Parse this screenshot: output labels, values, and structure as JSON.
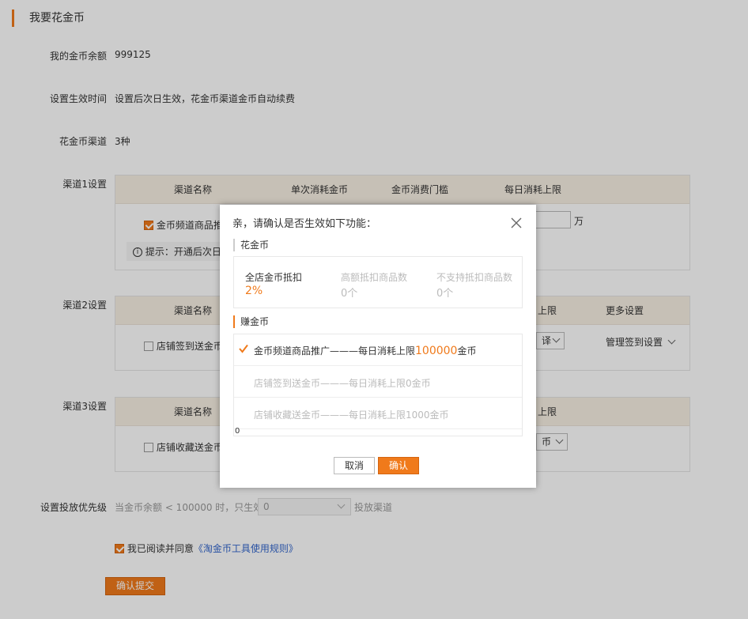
{
  "page": {
    "title": "我要花金币",
    "balance_label": "我的金币余额",
    "balance_value": "999125",
    "effect_label": "设置生效时间",
    "effect_value": "设置后次日生效，花金币渠道金币自动续费",
    "channels_label": "花金币渠道",
    "channels_value": "3种",
    "channel1": {
      "label": "渠道1设置",
      "headers": [
        "渠道名称",
        "单次消耗金币",
        "金币消费门槛",
        "每日消耗上限"
      ],
      "name": "金币频道商品推",
      "unit": "万",
      "tip": "提示：开通后次日"
    },
    "channel2": {
      "label": "渠道2设置",
      "header_name": "渠道名称",
      "header_limit": "上限",
      "header_more": "更多设置",
      "name": "店铺签到送金币",
      "select_tail": "译",
      "manage_link": "管理签到设置"
    },
    "channel3": {
      "label": "渠道3设置",
      "header_name": "渠道名称",
      "header_limit": "上限",
      "name": "店铺收藏送金币",
      "select_tail": "币"
    },
    "priority": {
      "label": "设置投放优先级",
      "prefix": "当金币余额 < 100000 时，只生效",
      "select_value": "0",
      "suffix": "投放渠道"
    },
    "agree": {
      "text": "我已阅读并同意",
      "link": "《淘金币工具使用规则》"
    },
    "submit": "确认提交"
  },
  "modal": {
    "title": "亲，请确认是否生效如下功能：",
    "spend_title": "花金币",
    "spend_items": [
      {
        "label": "全店金币抵扣",
        "value": "2%"
      },
      {
        "label": "高额抵扣商品数",
        "value": "0个"
      },
      {
        "label": "不支持抵扣商品数",
        "value": "0个"
      }
    ],
    "earn_title": "赚金币",
    "earn_rows": [
      {
        "prefix": "金币频道商品推广———每日消耗上限",
        "amount": "100000",
        "suffix": "金币",
        "checked": true
      },
      {
        "text": "店铺签到送金币———每日消耗上限0金币",
        "checked": false
      },
      {
        "text": "店铺收藏送金币———每日消耗上限1000金币",
        "checked": false
      }
    ],
    "scroll_value": "0",
    "cancel": "取消",
    "confirm": "确认"
  },
  "colors": {
    "accent": "#f07a1b",
    "header_bg": "#f8f0e4",
    "link": "#3366cc",
    "overlay": "rgba(0,0,0,0.2)"
  },
  "icons": [
    "check-icon",
    "info-icon",
    "close-icon",
    "chevron-down-icon",
    "checkmark-icon"
  ]
}
